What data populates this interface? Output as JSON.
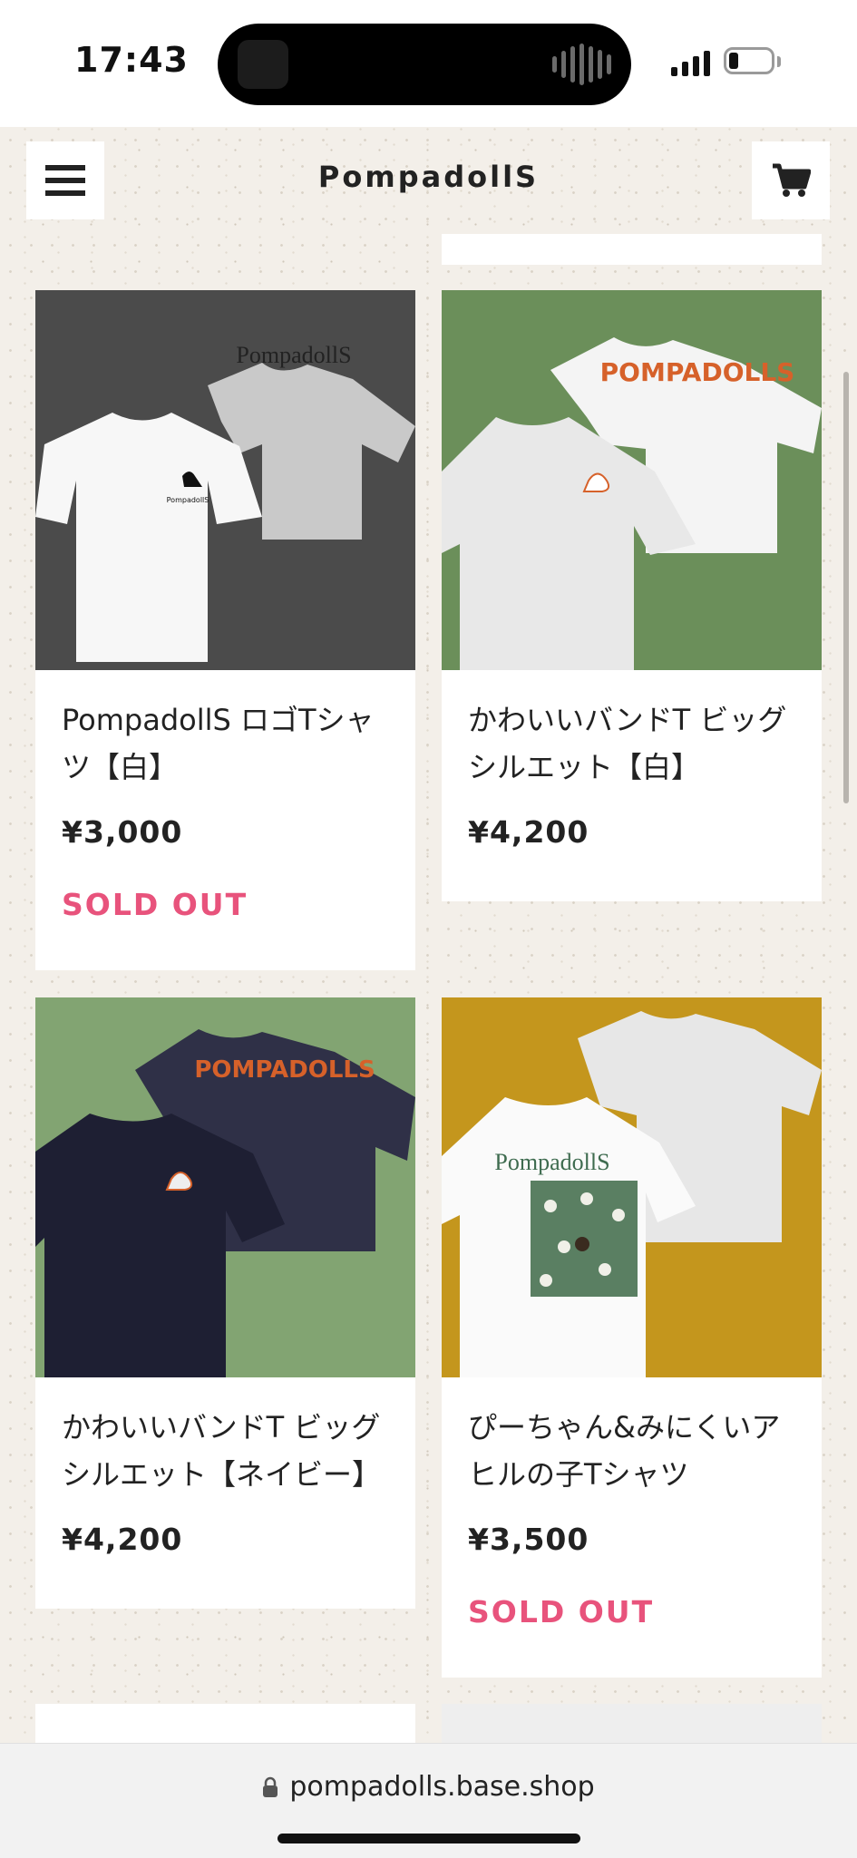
{
  "status_bar": {
    "time": "17:43"
  },
  "header": {
    "shop_name": "PompadollS"
  },
  "products": [
    {
      "name": "PompadollS ロゴTシャツ【白】",
      "price": "¥3,000",
      "status": "SOLD OUT",
      "image": "white-logo-tshirt",
      "bg_color": "#4b4b4b"
    },
    {
      "name": "かわいいバンドT ビッグシルエット【白】",
      "price": "¥4,200",
      "status": "",
      "image": "white-band-bigsilhouette-tshirt",
      "bg_color": "#6b8f5a"
    },
    {
      "name": "かわいいバンドT ビッグシルエット【ネイビー】",
      "price": "¥4,200",
      "status": "",
      "image": "navy-band-bigsilhouette-tshirt",
      "bg_color": "#82a472"
    },
    {
      "name": "ぴーちゃん&みにくいアヒルの子Tシャツ",
      "price": "¥3,500",
      "status": "SOLD OUT",
      "image": "duckling-print-tshirt",
      "bg_color": "#c4961d"
    }
  ],
  "colors": {
    "sold_out": "#e8537c",
    "page_bg": "#f3efe9",
    "text": "#222222"
  },
  "browser": {
    "url": "pompadolls.base.shop"
  }
}
